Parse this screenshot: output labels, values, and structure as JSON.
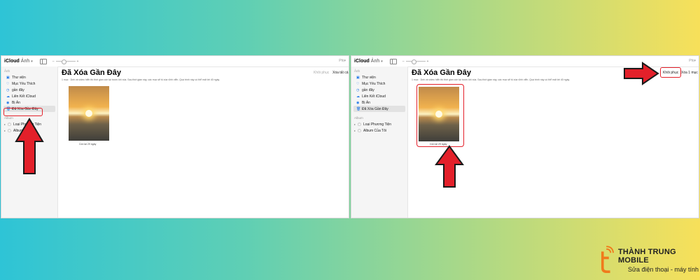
{
  "app": {
    "brand": "iCloud",
    "app_name": "Ảnh",
    "more_label": "Phị"
  },
  "sidebar": {
    "section_photos": "Ảnh",
    "items": [
      {
        "label": "Thư viện",
        "icon": "library-icon"
      },
      {
        "label": "Mục Yêu Thích",
        "icon": "heart-icon"
      },
      {
        "label": "gần đây",
        "icon": "clock-icon"
      },
      {
        "label": "Liên Kết iCloud",
        "icon": "link-icon"
      },
      {
        "label": "Bị Ẩn",
        "icon": "eye-slash-icon"
      },
      {
        "label": "Đã Xóa Gần Đây",
        "icon": "trash-icon"
      }
    ],
    "section_albums": "Album",
    "albums": [
      {
        "label": "Loại Phương Tiện"
      },
      {
        "label": "Album Của Tôi"
      }
    ]
  },
  "left": {
    "title": "Đã Xóa Gần Đây",
    "description": "1 mục · Ảnh và video hiển thị thời gian còn lại trước khi xóa. Sau thời gian này, các mục sẽ bị xóa vĩnh viễn. Quá trình này có thể mất tới 40 ngày.",
    "recover_label": "Khôi phục",
    "delete_label": "Xóa tất cả",
    "photo_caption": "Còn lại 29 ngày"
  },
  "right": {
    "title": "Đã Xóa Gần Đây",
    "description": "1 mục · Ảnh và video hiển thị thời gian còn lại trước khi xóa. Sau thời gian này, các mục sẽ bị xóa vĩnh viễn. Quá trình này có thể mất tới 40 ngày.",
    "recover_label": "Khôi phục",
    "delete_label": "Xóa 1 mục",
    "photo_caption": "Còn lại 29 ngày"
  },
  "logo": {
    "name": "THÀNH TRUNG MOBILE",
    "tagline": "Sửa điện thoại - máy tính"
  },
  "colors": {
    "accent": "#1a73e8",
    "highlight": "#e3202a"
  }
}
